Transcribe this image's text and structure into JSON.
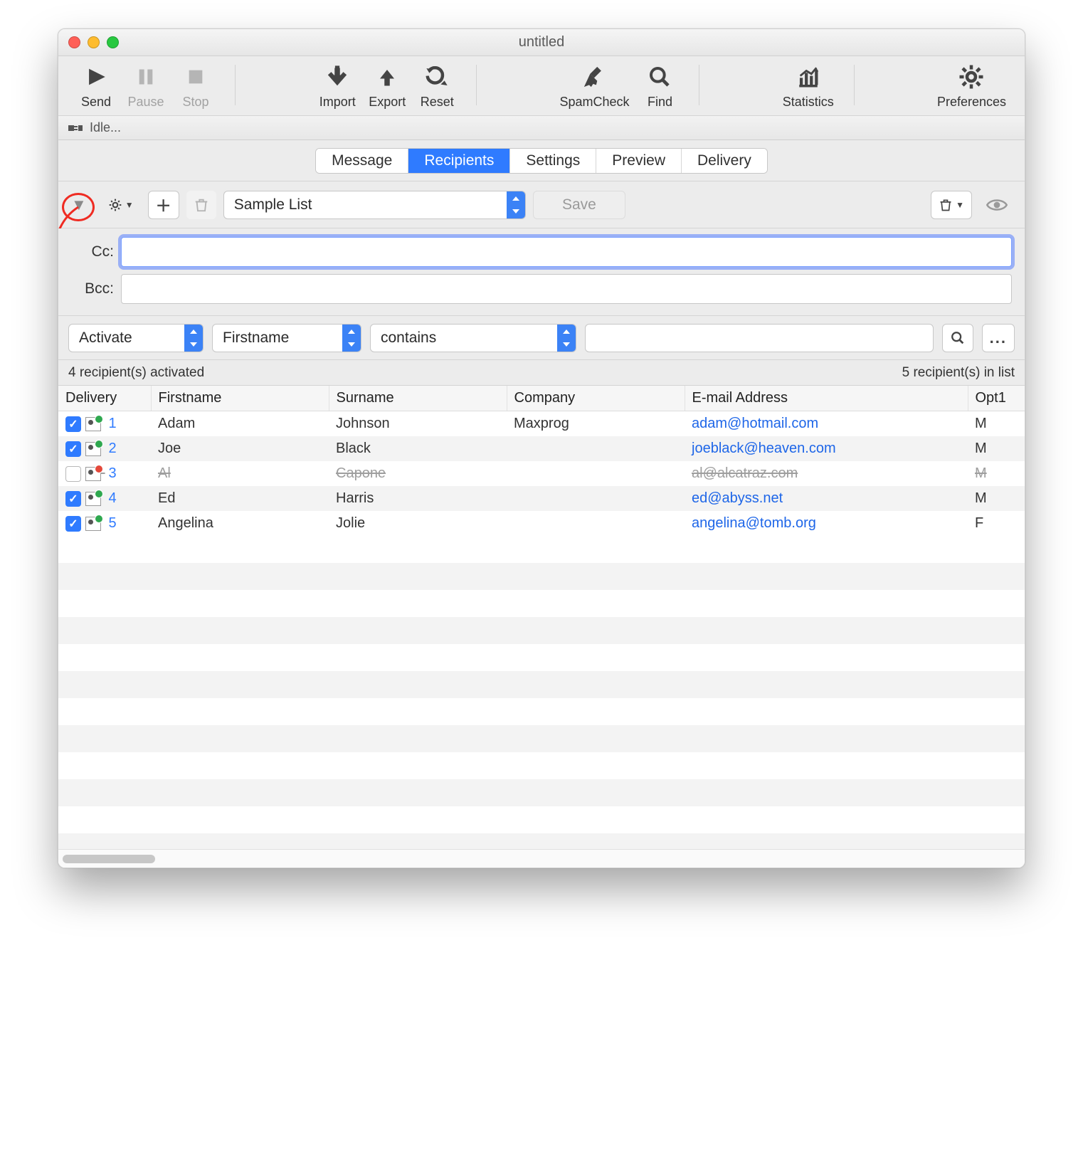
{
  "window": {
    "title": "untitled"
  },
  "toolbar": {
    "send": "Send",
    "pause": "Pause",
    "stop": "Stop",
    "import": "Import",
    "export": "Export",
    "reset": "Reset",
    "spamcheck": "SpamCheck",
    "find": "Find",
    "statistics": "Statistics",
    "preferences": "Preferences"
  },
  "status": {
    "text": "Idle..."
  },
  "tabs": {
    "items": [
      "Message",
      "Recipients",
      "Settings",
      "Preview",
      "Delivery"
    ],
    "active": "Recipients"
  },
  "list_toolbar": {
    "list_name": "Sample List",
    "save": "Save"
  },
  "ccbcc": {
    "cc_label": "Cc:",
    "bcc_label": "Bcc:",
    "cc_value": "",
    "bcc_value": ""
  },
  "filter": {
    "action": "Activate",
    "field": "Firstname",
    "op": "contains",
    "value": ""
  },
  "counts": {
    "activated": "4 recipient(s) activated",
    "total": "5 recipient(s) in list"
  },
  "columns": [
    "Delivery",
    "Firstname",
    "Surname",
    "Company",
    "E-mail Address",
    "Opt1"
  ],
  "rows": [
    {
      "n": "1",
      "checked": true,
      "status": "ok",
      "first": "Adam",
      "last": "Johnson",
      "company": "Maxprog",
      "email": "adam@hotmail.com",
      "opt": "M",
      "strike": false
    },
    {
      "n": "2",
      "checked": true,
      "status": "ok",
      "first": "Joe",
      "last": "Black",
      "company": "",
      "email": "joeblack@heaven.com",
      "opt": "M",
      "strike": false
    },
    {
      "n": "3",
      "checked": false,
      "status": "bad",
      "first": "Al",
      "last": "Capone",
      "company": "",
      "email": "al@alcatraz.com",
      "opt": "M",
      "strike": true
    },
    {
      "n": "4",
      "checked": true,
      "status": "ok",
      "first": "Ed",
      "last": "Harris",
      "company": "",
      "email": "ed@abyss.net",
      "opt": "M",
      "strike": false
    },
    {
      "n": "5",
      "checked": true,
      "status": "ok",
      "first": "Angelina",
      "last": "Jolie",
      "company": "",
      "email": "angelina@tomb.org",
      "opt": "F",
      "strike": false
    }
  ]
}
